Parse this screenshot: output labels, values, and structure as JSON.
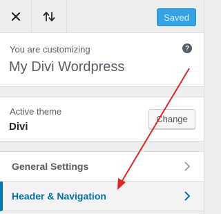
{
  "topbar": {
    "close_icon": "close-icon",
    "sort_icon": "sort-arrows-icon",
    "saved_label": "Saved"
  },
  "info": {
    "customizing_label": "You are customizing",
    "site_name": "My Divi Wordpress",
    "help_icon": "?"
  },
  "theme": {
    "active_label": "Active theme",
    "name": "Divi",
    "change_label": "Change"
  },
  "sections": [
    {
      "label": "General Settings"
    },
    {
      "label": "Header & Navigation"
    }
  ],
  "colors": {
    "accent": "#0073aa",
    "saved_bg": "#36a2e6",
    "annotation_arrow": "#e02424"
  }
}
